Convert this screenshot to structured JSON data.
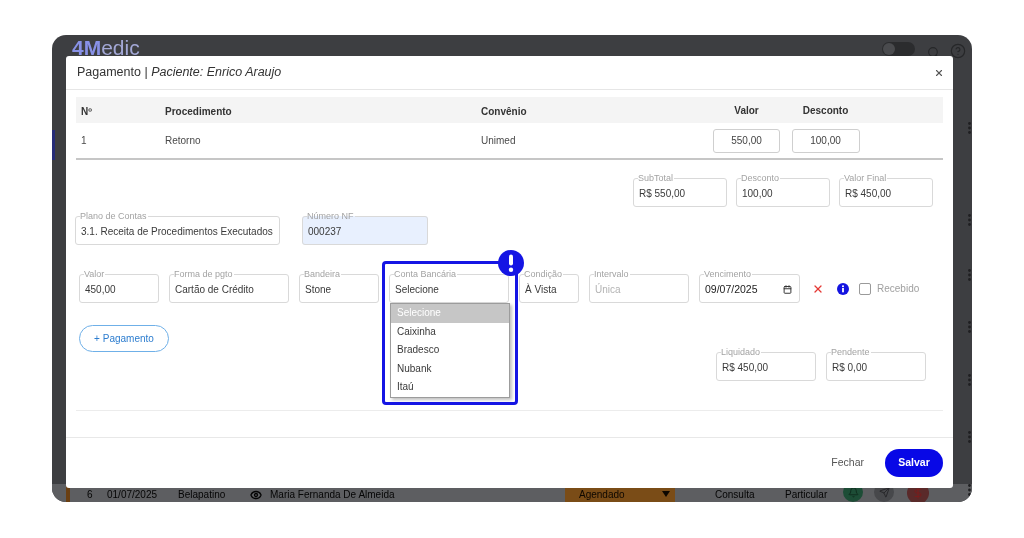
{
  "app_background": {
    "logo": "**4M**edic",
    "header_toggle": {
      "on": false
    },
    "row": {
      "column_1": "6",
      "column_2": "01/07/2025",
      "column_3": "Belapatino",
      "column_4": "Maria Fernanda De Almeida",
      "column_5": "Agendado",
      "column_6": "Consulta",
      "column_7": "Particular"
    }
  },
  "modal": {
    "title": "Pagamento | *Paciente: Enrico Araujo*",
    "table": {
      "columns": [
        "Nº",
        "Procedimento",
        "Convênio",
        "Valor",
        "Desconto"
      ],
      "rows": [
        {
          "number": "1",
          "procedure": "Retorno",
          "insurance": "Unimed",
          "value": "550,00",
          "discount": "100,00"
        }
      ]
    },
    "totals": [
      {
        "label": "SubTotal",
        "value": "R$ 550,00"
      },
      {
        "label": "Desconto",
        "value": "100,00"
      },
      {
        "label": "Valor Final",
        "value": "R$ 450,00"
      }
    ],
    "account_fields": [
      {
        "label": "Plano de Contas",
        "value": "3.1. Receita de Procedimentos Executados",
        "autofilled": false
      },
      {
        "label": "Número NF",
        "value": "000237",
        "autofilled": true
      }
    ],
    "payment": {
      "fields": [
        {
          "kind": "text",
          "label": "Valor",
          "value": "450,00"
        },
        {
          "kind": "text",
          "label": "Forma de pgto",
          "value": "Cartão de Crédito"
        },
        {
          "kind": "text",
          "label": "Bandeira",
          "value": "Stone"
        },
        {
          "kind": "select",
          "label": "Conta Bancária",
          "value": "Selecione",
          "expanded": true,
          "annotated": true,
          "options": [
            {
              "label": "Selecione",
              "selected": true
            },
            {
              "label": "Caixinha",
              "selected": false
            },
            {
              "label": "Bradesco",
              "selected": false
            },
            {
              "label": "Nubank",
              "selected": false
            },
            {
              "label": "Itaú",
              "selected": false
            }
          ]
        },
        {
          "kind": "text",
          "label": "Condição",
          "value": "À Vista"
        },
        {
          "kind": "text",
          "label": "Intervalo",
          "placeholder": "Única"
        },
        {
          "kind": "date",
          "label": "Vencimento",
          "value": "09/07/2025"
        }
      ],
      "received": {
        "label": "Recebido",
        "checked": false
      }
    },
    "add_payment_button": "+ Pagamento",
    "summary": [
      {
        "label": "Liquidado",
        "value": "R$ 450,00"
      },
      {
        "label": "Pendente",
        "value": "R$ 0,00"
      }
    ],
    "footer_buttons": [
      {
        "kind": "secondary",
        "label": "Fechar"
      },
      {
        "kind": "primary",
        "label": "Salvar"
      }
    ]
  }
}
